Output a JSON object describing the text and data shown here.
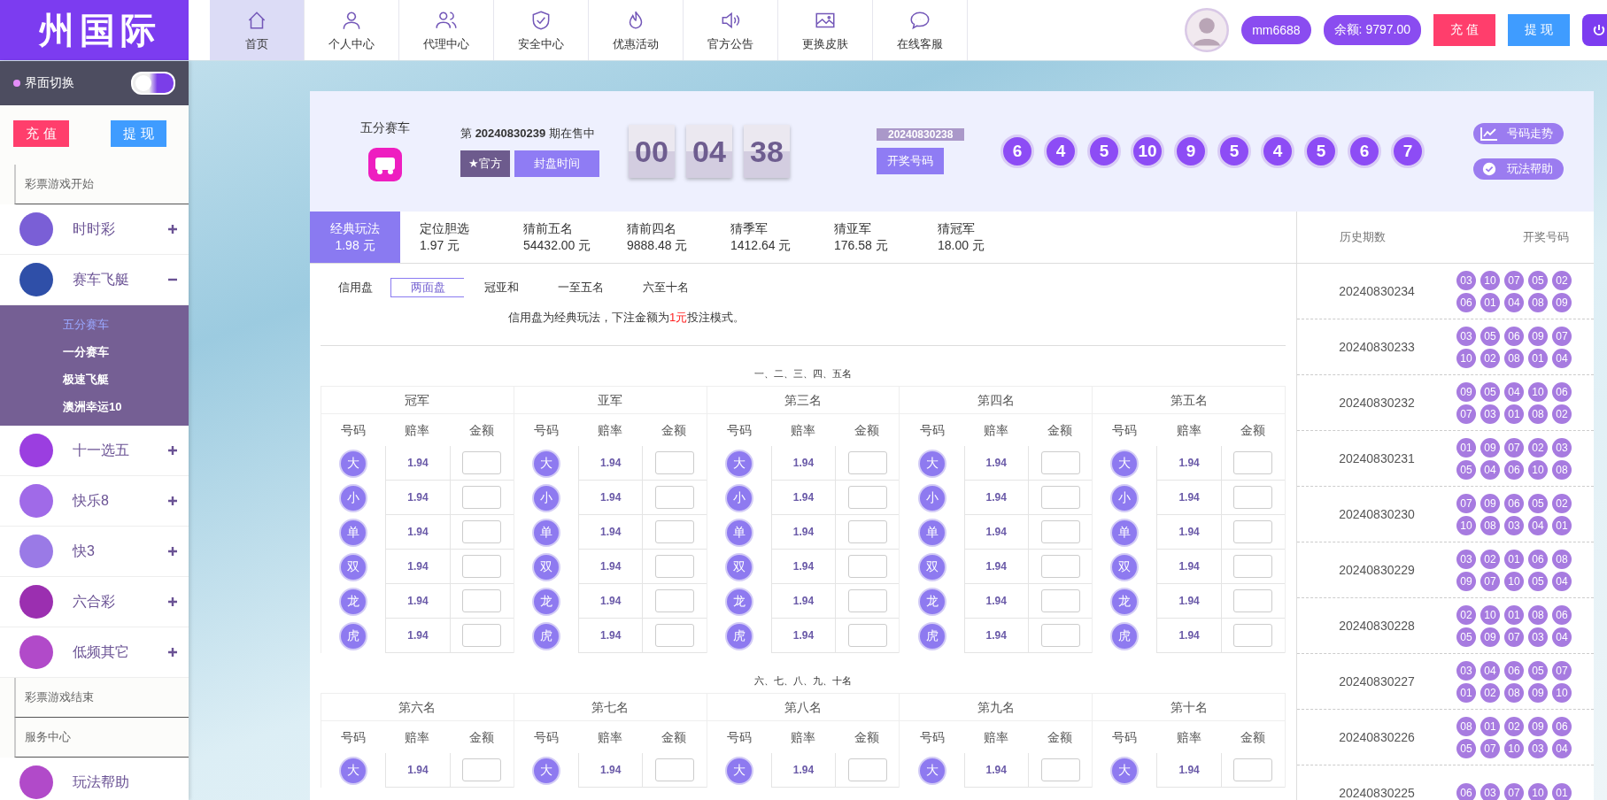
{
  "topbar": {
    "logo": "州国际",
    "nav": [
      {
        "label": "首页",
        "selected": true
      },
      {
        "label": "个人中心",
        "selected": false
      },
      {
        "label": "代理中心",
        "selected": false
      },
      {
        "label": "安全中心",
        "selected": false
      },
      {
        "label": "优惠活动",
        "selected": false
      },
      {
        "label": "官方公告",
        "selected": false
      },
      {
        "label": "更换皮肤",
        "selected": false
      },
      {
        "label": "在线客服",
        "selected": false
      }
    ],
    "username": "mm6688",
    "balance": "余额: 9797.00",
    "recharge": "充 值",
    "withdraw": "提 现"
  },
  "sidebar": {
    "toggle": {
      "label": "界面切换",
      "on": false
    },
    "recharge": "充 值",
    "withdraw": "提 现",
    "sections": [
      {
        "title": "彩票游戏开始",
        "items": [
          {
            "label": "时时彩",
            "expanded": false
          },
          {
            "label": "赛车飞艇",
            "expanded": true,
            "children": [
              {
                "label": "五分赛车",
                "selected": true
              },
              {
                "label": "一分赛车",
                "selected": false
              },
              {
                "label": "极速飞艇",
                "selected": false
              },
              {
                "label": "澳洲幸运10",
                "selected": false
              }
            ]
          },
          {
            "label": "十一选五",
            "expanded": false
          },
          {
            "label": "快乐8",
            "expanded": false
          },
          {
            "label": "快3",
            "expanded": false
          },
          {
            "label": "六合彩",
            "expanded": false
          },
          {
            "label": "低频其它",
            "expanded": false
          }
        ]
      },
      {
        "title": "彩票游戏结束"
      },
      {
        "title": "服务中心",
        "items": [
          {
            "label": "玩法帮助",
            "expanded": false
          }
        ]
      }
    ]
  },
  "game": {
    "name": "五分赛车",
    "period": "第 **20240830239** 期在售中",
    "official": "★官方",
    "close_time": "封盘时间",
    "countdown": [
      "00",
      "04",
      "38"
    ],
    "last_period": "20240830238",
    "draw_button": "开奖号码",
    "balls": [
      "6",
      "4",
      "5",
      "10",
      "9",
      "5",
      "4",
      "5",
      "6",
      "7"
    ],
    "trend": "号码走势",
    "help": "玩法帮助"
  },
  "play_tabs": [
    {
      "label": "经典玩法",
      "price": "1.98 元",
      "selected": true
    },
    {
      "label": "定位胆选",
      "price": "1.97 元",
      "selected": false
    },
    {
      "label": "猜前五名",
      "price": "54432.00 元",
      "selected": false
    },
    {
      "label": "猜前四名",
      "price": "9888.48 元",
      "selected": false
    },
    {
      "label": "猜季军",
      "price": "1412.64 元",
      "selected": false
    },
    {
      "label": "猜亚军",
      "price": "176.58 元",
      "selected": false
    },
    {
      "label": "猜冠军",
      "price": "18.00 元",
      "selected": false
    }
  ],
  "sub_label": "信用盘",
  "sub_tabs": [
    {
      "label": "两面盘",
      "selected": true
    },
    {
      "label": "冠亚和",
      "selected": false
    },
    {
      "label": "一至五名",
      "selected": false
    },
    {
      "label": "六至十名",
      "selected": false
    }
  ],
  "note": {
    "before": "信用盘为经典玩法，下注金额为",
    "highlight": "1元",
    "after": "投注模式。"
  },
  "groups": [
    {
      "caption": "一、二、三、四、五名",
      "positions": [
        {
          "name": "冠军",
          "columns": [
            "号码",
            "赔率",
            "金额"
          ],
          "rows": [
            {
              "ball": "大",
              "odds": "1.94"
            },
            {
              "ball": "小",
              "odds": "1.94"
            },
            {
              "ball": "单",
              "odds": "1.94"
            },
            {
              "ball": "双",
              "odds": "1.94"
            },
            {
              "ball": "龙",
              "odds": "1.94"
            },
            {
              "ball": "虎",
              "odds": "1.94"
            }
          ]
        },
        {
          "name": "亚军",
          "columns": [
            "号码",
            "赔率",
            "金额"
          ],
          "rows": [
            {
              "ball": "大",
              "odds": "1.94"
            },
            {
              "ball": "小",
              "odds": "1.94"
            },
            {
              "ball": "单",
              "odds": "1.94"
            },
            {
              "ball": "双",
              "odds": "1.94"
            },
            {
              "ball": "龙",
              "odds": "1.94"
            },
            {
              "ball": "虎",
              "odds": "1.94"
            }
          ]
        },
        {
          "name": "第三名",
          "columns": [
            "号码",
            "赔率",
            "金额"
          ],
          "rows": [
            {
              "ball": "大",
              "odds": "1.94"
            },
            {
              "ball": "小",
              "odds": "1.94"
            },
            {
              "ball": "单",
              "odds": "1.94"
            },
            {
              "ball": "双",
              "odds": "1.94"
            },
            {
              "ball": "龙",
              "odds": "1.94"
            },
            {
              "ball": "虎",
              "odds": "1.94"
            }
          ]
        },
        {
          "name": "第四名",
          "columns": [
            "号码",
            "赔率",
            "金额"
          ],
          "rows": [
            {
              "ball": "大",
              "odds": "1.94"
            },
            {
              "ball": "小",
              "odds": "1.94"
            },
            {
              "ball": "单",
              "odds": "1.94"
            },
            {
              "ball": "双",
              "odds": "1.94"
            },
            {
              "ball": "龙",
              "odds": "1.94"
            },
            {
              "ball": "虎",
              "odds": "1.94"
            }
          ]
        },
        {
          "name": "第五名",
          "columns": [
            "号码",
            "赔率",
            "金额"
          ],
          "rows": [
            {
              "ball": "大",
              "odds": "1.94"
            },
            {
              "ball": "小",
              "odds": "1.94"
            },
            {
              "ball": "单",
              "odds": "1.94"
            },
            {
              "ball": "双",
              "odds": "1.94"
            },
            {
              "ball": "龙",
              "odds": "1.94"
            },
            {
              "ball": "虎",
              "odds": "1.94"
            }
          ]
        }
      ]
    },
    {
      "caption": "六、七、八、九、十名",
      "positions": [
        {
          "name": "第六名",
          "columns": [
            "号码",
            "赔率",
            "金额"
          ],
          "rows": [
            {
              "ball": "大",
              "odds": "1.94"
            }
          ]
        },
        {
          "name": "第七名",
          "columns": [
            "号码",
            "赔率",
            "金额"
          ],
          "rows": [
            {
              "ball": "大",
              "odds": "1.94"
            }
          ]
        },
        {
          "name": "第八名",
          "columns": [
            "号码",
            "赔率",
            "金额"
          ],
          "rows": [
            {
              "ball": "大",
              "odds": "1.94"
            }
          ]
        },
        {
          "name": "第九名",
          "columns": [
            "号码",
            "赔率",
            "金额"
          ],
          "rows": [
            {
              "ball": "大",
              "odds": "1.94"
            }
          ]
        },
        {
          "name": "第十名",
          "columns": [
            "号码",
            "赔率",
            "金额"
          ],
          "rows": [
            {
              "ball": "大",
              "odds": "1.94"
            }
          ]
        }
      ]
    }
  ],
  "history": {
    "columns": [
      "历史期数",
      "开奖号码"
    ],
    "rows": [
      {
        "period": "20240830234",
        "numbers": [
          "03",
          "10",
          "07",
          "05",
          "02",
          "06",
          "01",
          "04",
          "08",
          "09"
        ]
      },
      {
        "period": "20240830233",
        "numbers": [
          "03",
          "05",
          "06",
          "09",
          "07",
          "10",
          "02",
          "08",
          "01",
          "04"
        ]
      },
      {
        "period": "20240830232",
        "numbers": [
          "09",
          "05",
          "04",
          "10",
          "06",
          "07",
          "03",
          "01",
          "08",
          "02"
        ]
      },
      {
        "period": "20240830231",
        "numbers": [
          "01",
          "09",
          "07",
          "02",
          "03",
          "05",
          "04",
          "06",
          "10",
          "08"
        ]
      },
      {
        "period": "20240830230",
        "numbers": [
          "07",
          "09",
          "06",
          "05",
          "02",
          "10",
          "08",
          "03",
          "04",
          "01"
        ]
      },
      {
        "period": "20240830229",
        "numbers": [
          "03",
          "02",
          "01",
          "06",
          "08",
          "09",
          "07",
          "10",
          "05",
          "04"
        ]
      },
      {
        "period": "20240830228",
        "numbers": [
          "02",
          "10",
          "01",
          "08",
          "06",
          "05",
          "09",
          "07",
          "03",
          "04"
        ]
      },
      {
        "period": "20240830227",
        "numbers": [
          "03",
          "04",
          "06",
          "05",
          "07",
          "01",
          "02",
          "08",
          "09",
          "10"
        ]
      },
      {
        "period": "20240830226",
        "numbers": [
          "08",
          "01",
          "02",
          "09",
          "06",
          "05",
          "07",
          "10",
          "03",
          "04"
        ]
      },
      {
        "period": "20240830225",
        "numbers": [
          "06",
          "03",
          "07",
          "10",
          "01"
        ]
      }
    ]
  }
}
